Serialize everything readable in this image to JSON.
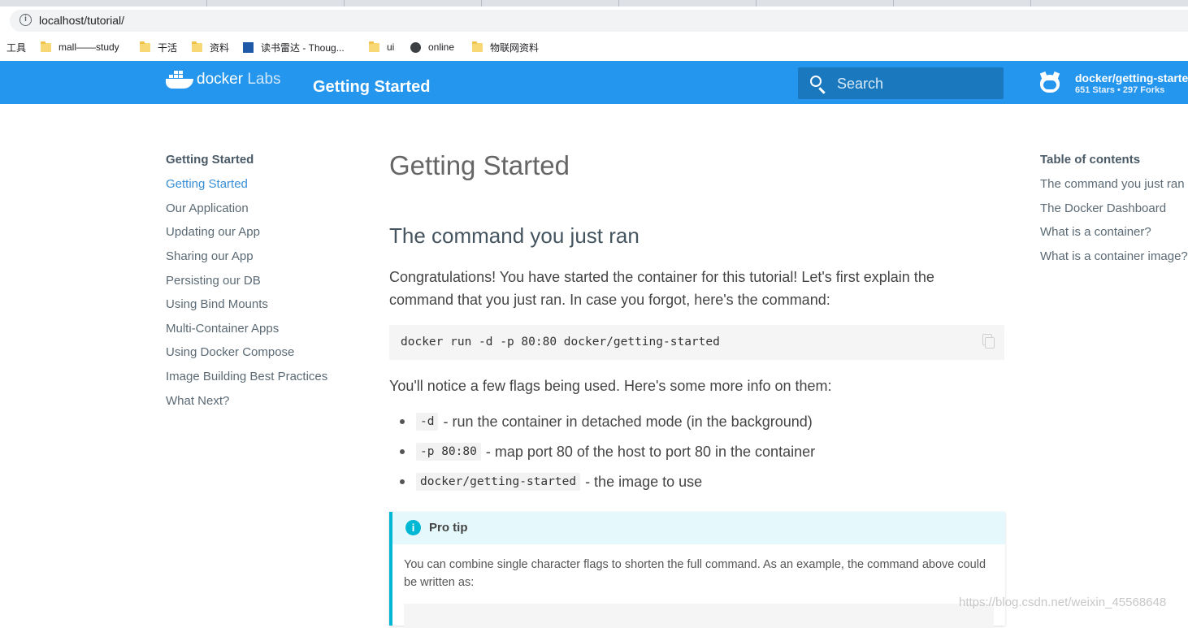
{
  "browser": {
    "url": "localhost/tutorial/",
    "bookmarks": [
      {
        "label": "工具",
        "icon": "none"
      },
      {
        "label": "mall——study",
        "icon": "folder-icon"
      },
      {
        "label": "干活",
        "icon": "folder-icon"
      },
      {
        "label": "资料",
        "icon": "folder-icon"
      },
      {
        "label": "读书雷达 - Thoug...",
        "icon": "site-favicon-icon"
      },
      {
        "label": "ui",
        "icon": "folder-icon"
      },
      {
        "label": "online",
        "icon": "globe-icon"
      },
      {
        "label": "物联网资料",
        "icon": "folder-icon"
      }
    ]
  },
  "header": {
    "logo_main": "docker",
    "logo_sub": "Labs",
    "title": "Getting Started",
    "search_placeholder": "Search",
    "repo_name": "docker/getting-started",
    "repo_stats": "651 Stars • 297 Forks",
    "brand_color": "#2496ed"
  },
  "nav": {
    "title": "Getting Started",
    "items": [
      "Getting Started",
      "Our Application",
      "Updating our App",
      "Sharing our App",
      "Persisting our DB",
      "Using Bind Mounts",
      "Multi-Container Apps",
      "Using Docker Compose",
      "Image Building Best Practices",
      "What Next?"
    ],
    "active_index": 0
  },
  "main": {
    "h1": "Getting Started",
    "h2": "The command you just ran",
    "intro": "Congratulations! You have started the container for this tutorial! Let's first explain the command that you just ran. In case you forgot, here's the command:",
    "command": "docker run -d -p 80:80 docker/getting-started",
    "flags_intro": "You'll notice a few flags being used. Here's some more info on them:",
    "flags": [
      {
        "code": "-d",
        "desc": "- run the container in detached mode (in the background)"
      },
      {
        "code": "-p 80:80",
        "desc": "- map port 80 of the host to port 80 in the container"
      },
      {
        "code": "docker/getting-started",
        "desc": "- the image to use"
      }
    ],
    "tip": {
      "title": "Pro tip",
      "body": "You can combine single character flags to shorten the full command. As an example, the command above could be written as:"
    }
  },
  "toc": {
    "title": "Table of contents",
    "items": [
      "The command you just ran",
      "The Docker Dashboard",
      "What is a container?",
      "What is a container image?"
    ]
  },
  "watermark": "https://blog.csdn.net/weixin_45568648"
}
